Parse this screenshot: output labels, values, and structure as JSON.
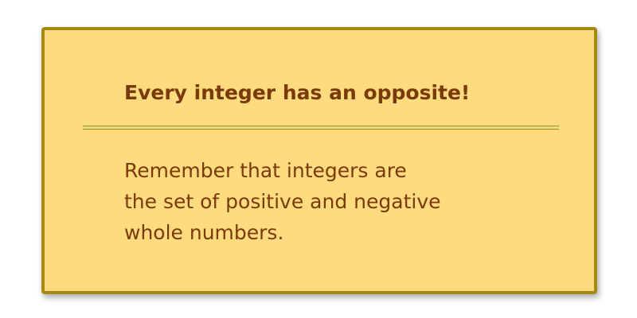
{
  "callout": {
    "title": "Every integer has an opposite!",
    "body_lines": [
      "Remember that integers are",
      "the set of positive and negative",
      "whole numbers."
    ]
  },
  "colors": {
    "card_background": "#fedb7f",
    "card_border": "#a68a14",
    "text": "#7a3a0a"
  }
}
